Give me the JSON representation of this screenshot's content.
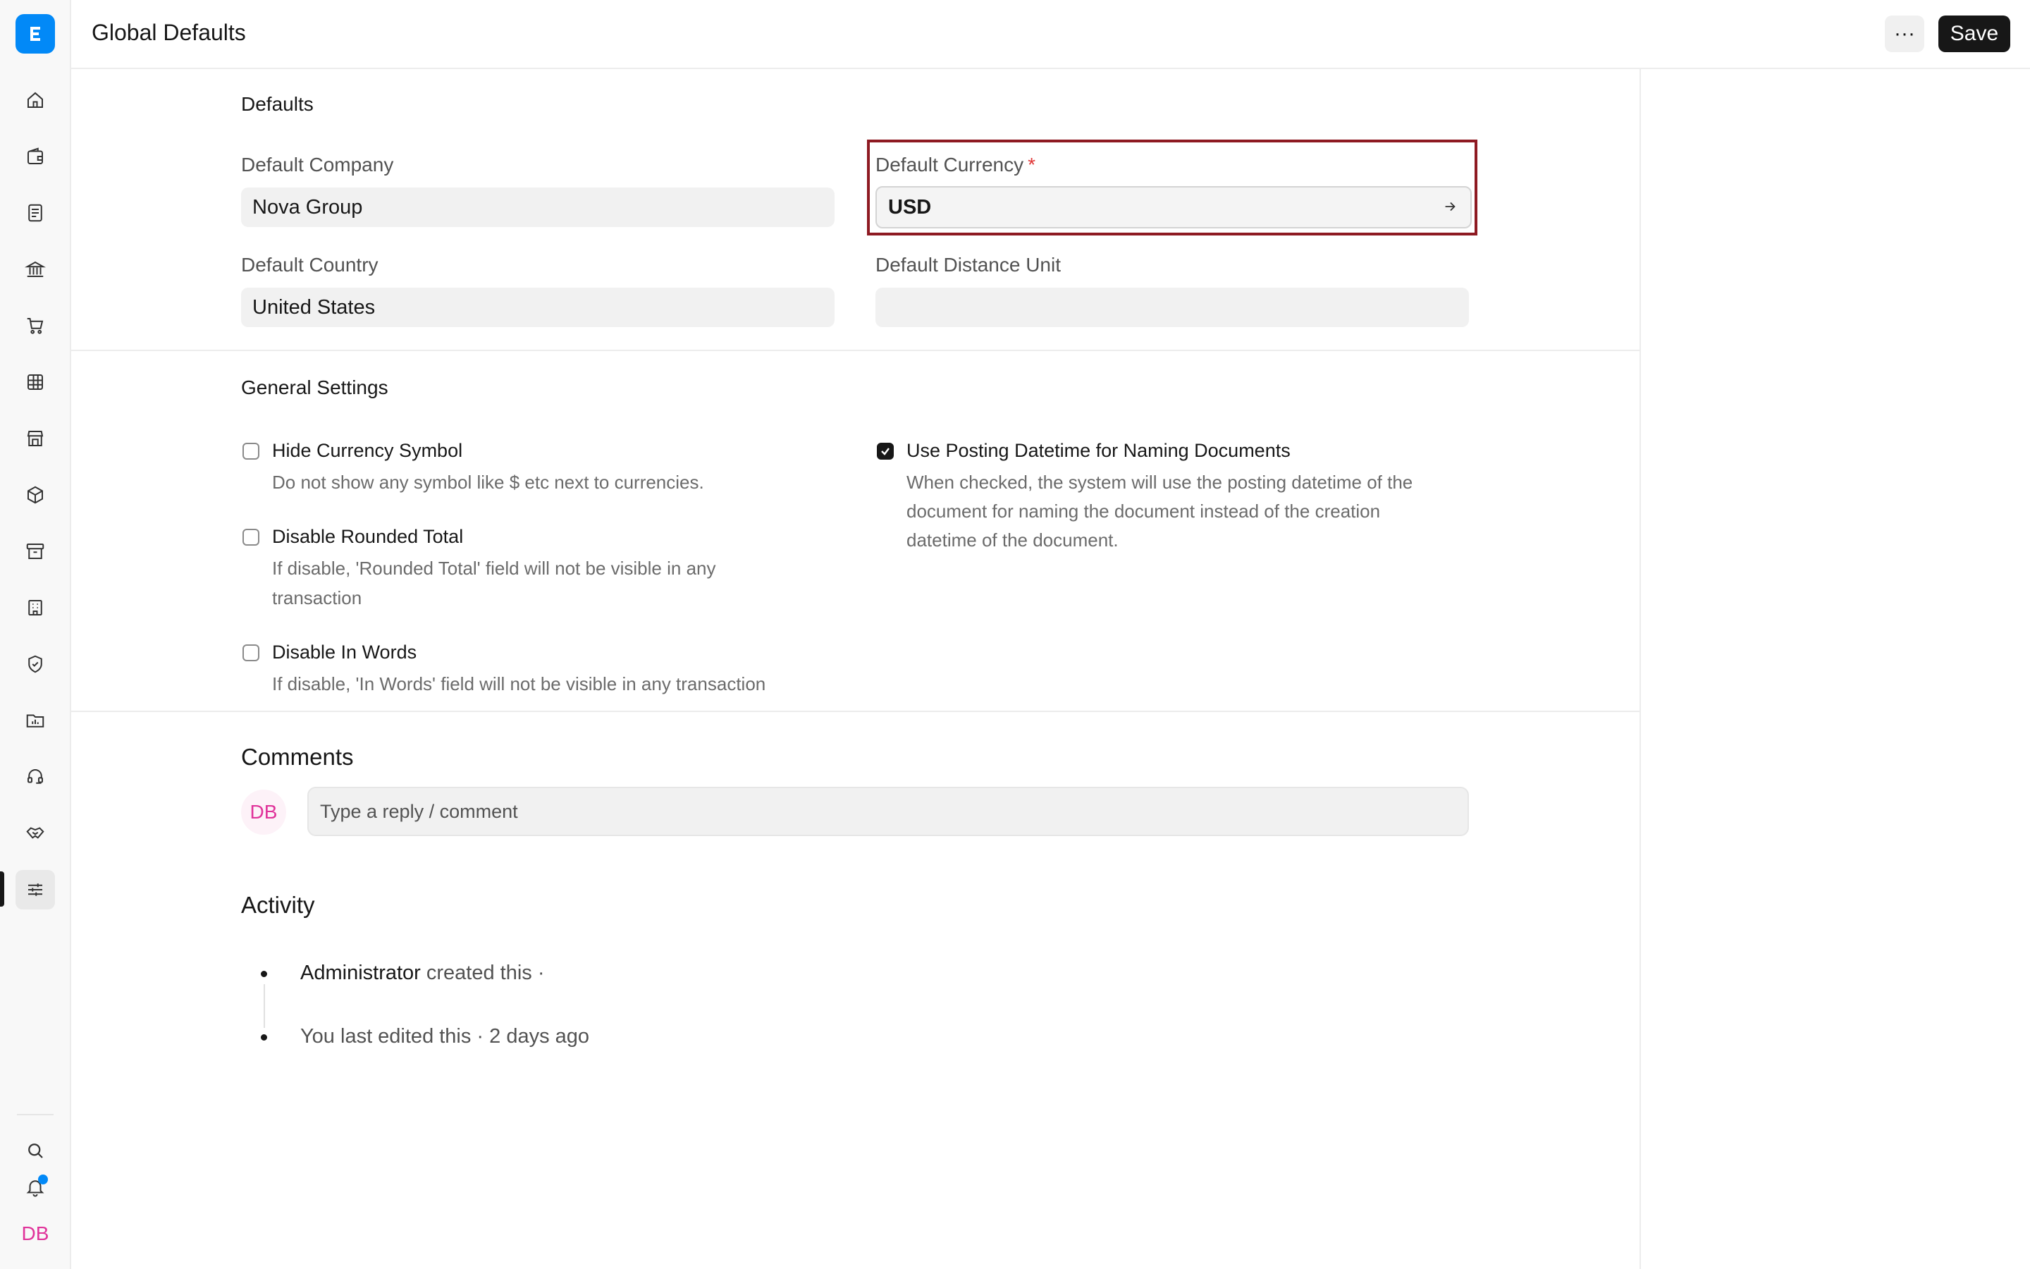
{
  "header": {
    "title": "Global Defaults",
    "more_label": "···",
    "save_label": "Save"
  },
  "sidebar": {
    "avatar_initials": "DB",
    "items": [
      {
        "icon": "home-icon"
      },
      {
        "icon": "wallet-icon"
      },
      {
        "icon": "document-icon"
      },
      {
        "icon": "bank-icon"
      },
      {
        "icon": "cart-icon"
      },
      {
        "icon": "table-icon"
      },
      {
        "icon": "store-icon"
      },
      {
        "icon": "package-icon"
      },
      {
        "icon": "archive-icon"
      },
      {
        "icon": "building-icon"
      },
      {
        "icon": "shield-icon"
      },
      {
        "icon": "folder-chart-icon"
      },
      {
        "icon": "headset-icon"
      },
      {
        "icon": "handshake-icon"
      },
      {
        "icon": "sliders-icon",
        "active": true
      }
    ]
  },
  "defaults": {
    "section_title": "Defaults",
    "company": {
      "label": "Default Company",
      "value": "Nova Group"
    },
    "currency": {
      "label": "Default Currency",
      "required_mark": "*",
      "value": "USD"
    },
    "country": {
      "label": "Default Country",
      "value": "United States"
    },
    "distance_unit": {
      "label": "Default Distance Unit",
      "value": ""
    }
  },
  "general": {
    "section_title": "General Settings",
    "hide_currency_symbol": {
      "label": "Hide Currency Symbol",
      "description": "Do not show any symbol like $ etc next to currencies.",
      "checked": false
    },
    "disable_rounded_total": {
      "label": "Disable Rounded Total",
      "description_line1": "If disable, 'Rounded Total' field will not be visible in any",
      "description_line2": "transaction",
      "checked": false
    },
    "disable_in_words": {
      "label": "Disable In Words",
      "description": "If disable, 'In Words' field will not be visible in any transaction",
      "checked": false
    },
    "use_posting_datetime": {
      "label": "Use Posting Datetime for Naming Documents",
      "description_line1": "When checked, the system will use the posting datetime of the",
      "description_line2": "document for naming the document instead of the creation",
      "description_line3": "datetime of the document.",
      "checked": true
    }
  },
  "comments": {
    "title": "Comments",
    "avatar_initials": "DB",
    "placeholder": "Type a reply / comment"
  },
  "activity": {
    "title": "Activity",
    "items": [
      {
        "who": "Administrator",
        "text": " created this ·"
      },
      {
        "who": "",
        "text": "You last edited this · 2 days ago"
      }
    ]
  },
  "colors": {
    "brand": "#0289f7",
    "highlight_border": "#8e1a22",
    "avatar_pink": "#e0339a"
  }
}
